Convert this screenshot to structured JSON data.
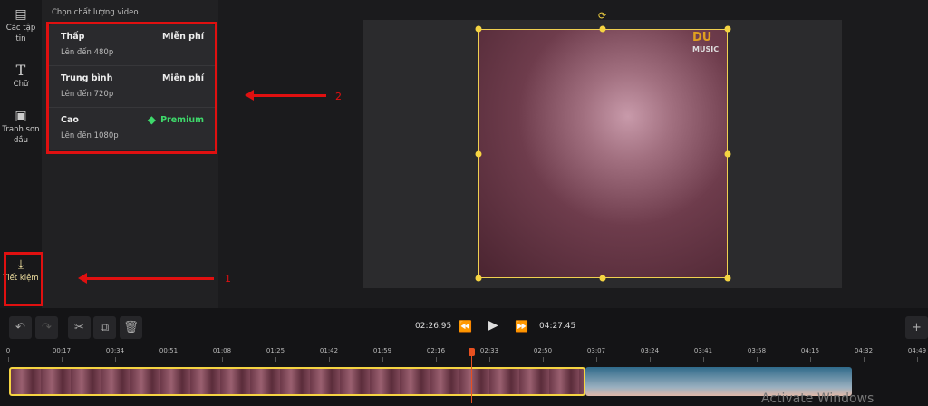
{
  "sidebar": {
    "items": [
      {
        "label": "Các tập tin",
        "icon": "archive-icon"
      },
      {
        "label": "Chữ",
        "icon": "text-icon"
      },
      {
        "label": "Tranh sơn dầu",
        "icon": "canvas-icon"
      },
      {
        "label": "Tiết kiệm",
        "icon": "download-icon"
      }
    ]
  },
  "quality_panel": {
    "title": "Chọn chất lượng video",
    "options": [
      {
        "name": "Thấp",
        "sub": "Lên đến 480p",
        "price": "Miễn phí"
      },
      {
        "name": "Trung bình",
        "sub": "Lên đến 720p",
        "price": "Miễn phí"
      },
      {
        "name": "Cao",
        "sub": "Lên đến 1080p",
        "price": "Premium",
        "icon": "diamond-icon"
      }
    ]
  },
  "annotations": {
    "label1": "1",
    "label2": "2",
    "color": "#e01010"
  },
  "video": {
    "logo_text": "DUCK MUSIC"
  },
  "player": {
    "current_time": "02:26.95",
    "total_time": "04:27.45"
  },
  "timeline": {
    "ticks": [
      "0",
      "00:17",
      "00:34",
      "00:51",
      "01:08",
      "01:25",
      "01:42",
      "01:59",
      "02:16",
      "02:33",
      "02:50",
      "03:07",
      "03:24",
      "03:41",
      "03:58",
      "04:15",
      "04:32",
      "04:49"
    ]
  },
  "watermark": "Activate Windows",
  "colors": {
    "accent": "#f5d442",
    "premium": "#3ed96b",
    "playhead": "#e85020"
  }
}
